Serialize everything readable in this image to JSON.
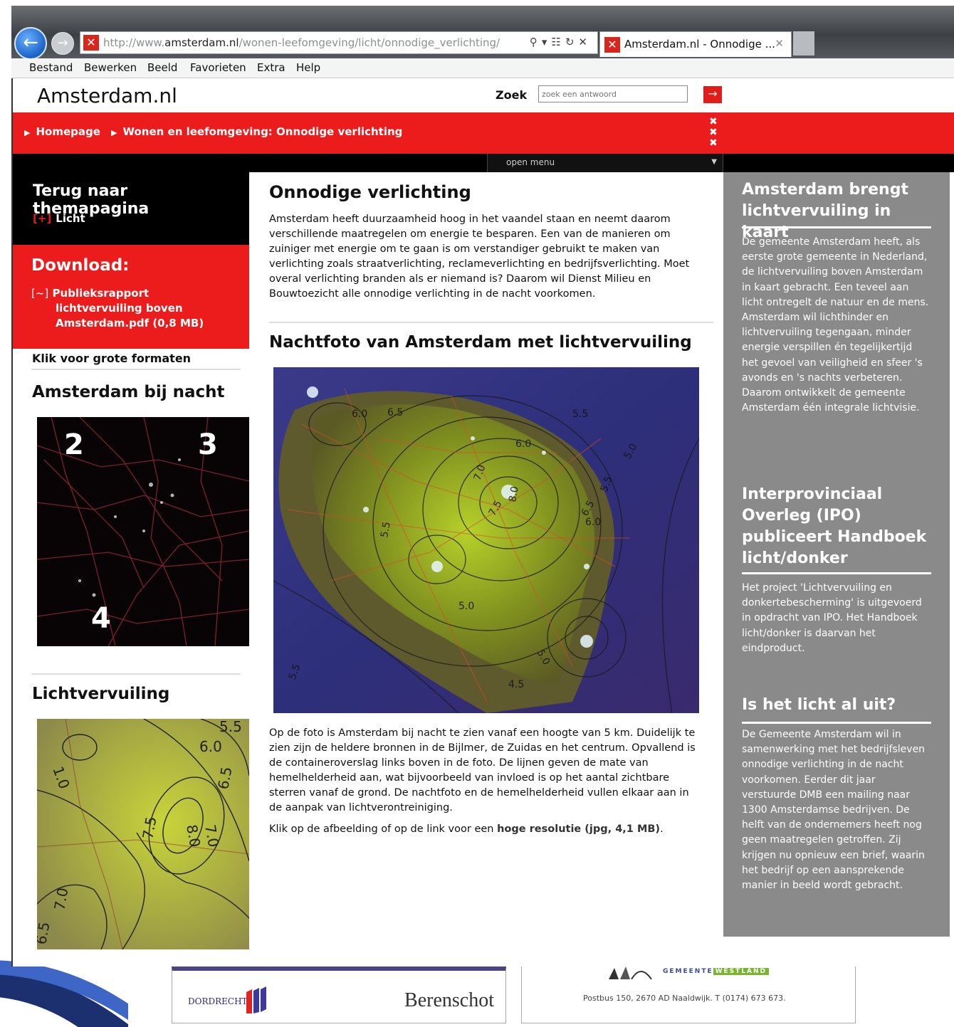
{
  "browser": {
    "url_prefix": "http://www.",
    "url_domain": "amsterdam.nl",
    "url_path": "/wonen-leefomgeving/licht/onnodige_verlichting/",
    "tab_title": "Amsterdam.nl - Onnodige ...",
    "menu": [
      "Bestand",
      "Bewerken",
      "Beeld",
      "Favorieten",
      "Extra",
      "Help"
    ]
  },
  "site": {
    "logo": "Amsterdam.nl",
    "search_label": "Zoek",
    "search_placeholder": "zoek een antwoord",
    "breadcrumb": [
      "Homepage",
      "Wonen en leefomgeving: Onnodige verlichting"
    ],
    "menu_toggle": "open menu"
  },
  "left": {
    "back_title": "Terug naar themapagina",
    "back_marker": "[+]",
    "back_link": "Licht",
    "download_title": "Download:",
    "download_marker": "[~]",
    "download_line1": "Publieksrapport",
    "download_line2": "lichtvervuiling boven",
    "download_line3": "Amsterdam.pdf (0,8 MB)",
    "klik": "Klik voor grote formaten",
    "night_title": "Amsterdam bij nacht",
    "night_labels": [
      "2",
      "3",
      "4"
    ],
    "pollution_title": "Lichtvervuiling",
    "pollution_contours": [
      "5.5",
      "6.0",
      "1.0",
      "6.5",
      "8.0",
      "7.0",
      "7.5",
      "7.0",
      "6.5"
    ]
  },
  "main": {
    "title": "Onnodige verlichting",
    "intro": "Amsterdam heeft duurzaamheid hoog in het vaandel staan en neemt daarom verschillende maatregelen om energie te besparen. Een van de manieren om zuiniger met energie om te gaan is om verstandiger gebruikt te maken van verlichting zoals straatverlichting, reclameverlichting en bedrijfsverlichting. Moet overal verlichting branden als er niemand is? Daarom wil Dienst Milieu en Bouwtoezicht alle onnodige verlichting in de nacht voorkomen.",
    "photo_title": "Nachtfoto van Amsterdam met lichtvervuiling",
    "map_contours": [
      "6.0",
      "6.5",
      "7.0",
      "5.5",
      "6.0",
      "7.5",
      "8.0",
      "6.5",
      "6.0",
      "5.5",
      "5.0",
      "5.5",
      "5.0",
      "5.5",
      "4.5",
      "5.0"
    ],
    "caption": "Op de foto is Amsterdam bij nacht te zien vanaf een hoogte van 5 km. Duidelijk te zien zijn de heldere bronnen in de Bijlmer, de Zuidas en het centrum. Opvallend is de containeroverslag links boven in de foto. De lijnen geven de mate van hemelhelderheid aan, wat bijvoorbeeld van invloed is op het aantal zichtbare sterren vanaf de grond. De nachtfoto en de hemelhelderheid vullen elkaar aan in de aanpak van lichtverontreiniging.",
    "click_text": "Klik op de afbeelding of op de link voor een ",
    "click_link": "hoge resolutie (jpg, 4,1 MB)",
    "click_end": "."
  },
  "right": {
    "b1_title": "Amsterdam brengt lichtvervuiling in kaart",
    "b1_text": "De gemeente Amsterdam heeft, als eerste grote gemeente in Nederland, de lichtvervuiling boven Amsterdam in kaart gebracht. Een teveel aan licht ontregelt de natuur en de mens. Amsterdam wil lichthinder en lichtvervuiling tegengaan, minder energie verspillen én tegelijkertijd het gevoel van veiligheid en sfeer 's avonds en 's nachts verbeteren. Daarom ontwikkelt de gemeente Amsterdam één integrale lichtvisie.",
    "b2_title": "Interprovinciaal Overleg (IPO) publiceert Handboek licht/donker",
    "b2_text": "Het project 'Lichtvervuiling en donkertebescherming' is uitgevoerd in opdracht van IPO. Het Handboek licht/donker is daarvan het eindproduct.",
    "b3_title": "Is het licht al uit?",
    "b3_text": "De Gemeente Amsterdam wil in samenwerking met het bedrijfsleven onnodige verlichting in de nacht voorkomen. Eerder dit jaar verstuurde DMB een mailing naar 1300 Amsterdamse bedrijven. De helft van de ondernemers heeft nog geen maatregelen getroffen. Zij krijgen nu opnieuw een brief, waarin het bedrijf op een aansprekende manier in beeld wordt gebracht."
  },
  "footer": {
    "dordrecht": "DORDRECHT",
    "berenschot": "Berenschot",
    "westland_a": "GEMEENTE",
    "westland_b": "WESTLAND",
    "address": "Postbus 150, 2670 AD  Naaldwijk. T (0174) 673 673."
  },
  "colors": {
    "red": "#ec1c1c",
    "grey_panel": "#8a8a8a",
    "black": "#000000"
  }
}
